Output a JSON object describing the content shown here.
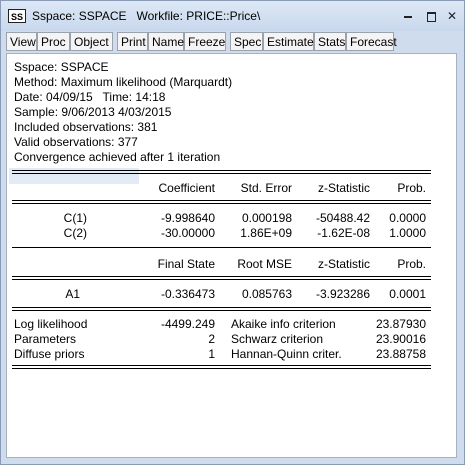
{
  "window": {
    "icon_label": "SS",
    "title": "Sspace: SSPACE   Workfile: PRICE::Price\\"
  },
  "toolbar": {
    "buttons": [
      "View",
      "Proc",
      "Object",
      "Print",
      "Name",
      "Freeze",
      "Spec",
      "Estimate",
      "Stats",
      "Forecast"
    ]
  },
  "header_lines": [
    "Sspace: SSPACE",
    "Method: Maximum likelihood (Marquardt)",
    "Date: 04/09/15   Time: 14:18",
    "Sample: 9/06/2013 4/03/2015",
    "Included observations: 381",
    "Valid observations: 377",
    "Convergence achieved after 1 iteration"
  ],
  "coef_table": {
    "columns": [
      "Coefficient",
      "Std. Error",
      "z-Statistic",
      "Prob."
    ],
    "rows": [
      {
        "name": "C(1)",
        "values": [
          "-9.998640",
          "0.000198",
          "-50488.42",
          "0.0000"
        ]
      },
      {
        "name": "C(2)",
        "values": [
          "-30.00000",
          "1.86E+09",
          "-1.62E-08",
          "1.0000"
        ]
      }
    ]
  },
  "state_table": {
    "columns": [
      "Final State",
      "Root MSE",
      "z-Statistic",
      "Prob."
    ],
    "rows": [
      {
        "name": "A1",
        "values": [
          "-0.336473",
          "0.085763",
          "-3.923286",
          "0.0001"
        ]
      }
    ]
  },
  "stats": [
    {
      "label": "Log likelihood",
      "value": "-4499.249",
      "crit_label": "Akaike info criterion",
      "crit_value": "23.87930"
    },
    {
      "label": "Parameters",
      "value": "2",
      "crit_label": "Schwarz criterion",
      "crit_value": "23.90016"
    },
    {
      "label": "Diffuse priors",
      "value": "1",
      "crit_label": "Hannan-Quinn criter.",
      "crit_value": "23.88758"
    }
  ]
}
